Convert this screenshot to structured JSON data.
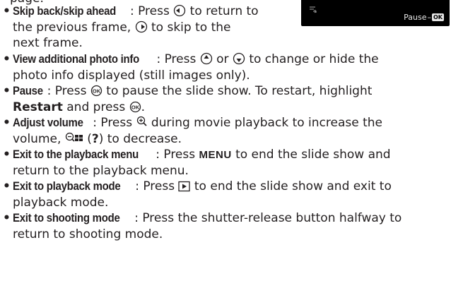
{
  "fragment": {
    "text": "page."
  },
  "preview": {
    "pause_label": "Pause",
    "ok_label": "OK"
  },
  "items": [
    {
      "label": "Skip back/skip ahead",
      "line1_a": ": Press ",
      "line1_b": " to return to",
      "line2_a": "the previous frame, ",
      "line2_b": " to skip to the",
      "line3": "next frame."
    },
    {
      "label": "View additional photo info",
      "line1_a": ": Press ",
      "line1_b": " or ",
      "line1_c": " to change or hide the",
      "line2": "photo info displayed (still images only)."
    },
    {
      "label": "Pause",
      "line1_a": ": Press ",
      "line1_b": " to pause the slide show. To restart, highlight",
      "line2_bold": "Restart",
      "line2_b": " and press ",
      "line2_c": "."
    },
    {
      "label": "Adjust volume",
      "line1_a": ": Press ",
      "line1_b": " during movie playback to increase the",
      "line2_a": "volume, ",
      "line2_paren_open": " (",
      "line2_q": "?",
      "line2_b": ") to decrease."
    },
    {
      "label": "Exit to the playback menu",
      "line1_a": ": Press ",
      "menu_word": "MENU",
      "line1_b": " to end the slide show and",
      "line2": "return to the playback menu."
    },
    {
      "label": "Exit to playback mode",
      "line1_a": ": Press ",
      "line1_b": " to end the slide show and exit to",
      "line2": "playback mode."
    },
    {
      "label": "Exit to shooting mode",
      "line1_a": ": Press the shutter-release button halfway to",
      "line2": "return to shooting mode."
    }
  ]
}
